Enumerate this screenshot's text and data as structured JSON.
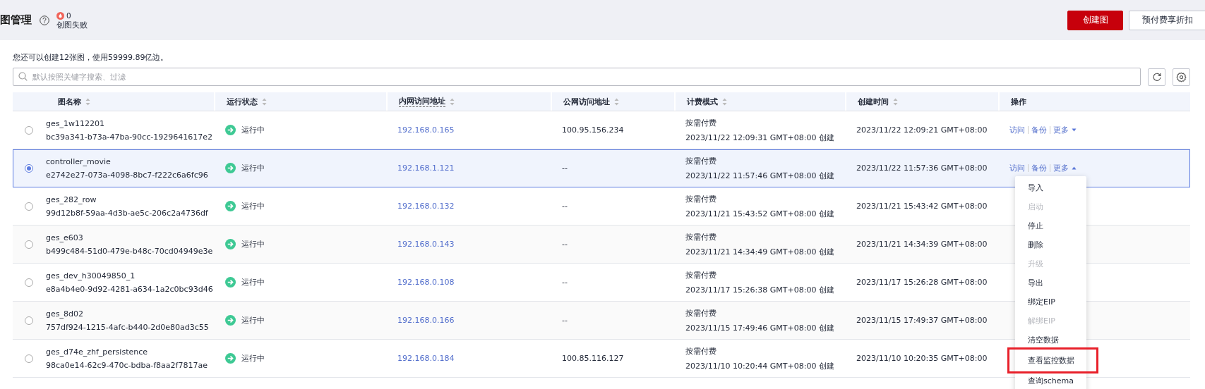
{
  "header": {
    "title": "图管理",
    "failed_count": "0",
    "failed_label": "创图失败",
    "buttons": [
      {
        "label": "创建图",
        "kind": "primary"
      },
      {
        "label": "预付费享折扣",
        "kind": "default"
      }
    ]
  },
  "quota_note": "您还可以创建12张图，使用59999.89亿边。",
  "search": {
    "placeholder": "默认按照关键字搜索、过滤"
  },
  "table": {
    "columns": [
      {
        "label": "图名称",
        "sortable": true,
        "dashed": false
      },
      {
        "label": "运行状态",
        "sortable": true,
        "dashed": false
      },
      {
        "label": "内网访问地址",
        "sortable": true,
        "dashed": true
      },
      {
        "label": "公网访问地址",
        "sortable": true,
        "dashed": false
      },
      {
        "label": "计费模式",
        "sortable": true,
        "dashed": false
      },
      {
        "label": "创建时间",
        "sortable": true,
        "dashed": false
      },
      {
        "label": "操作",
        "sortable": false,
        "dashed": false
      }
    ],
    "rows": [
      {
        "selected": false,
        "name": "ges_1w112201",
        "id": "bc39a341-b73a-47ba-90cc-1929641617e2",
        "status": "运行中",
        "private_ip": "192.168.0.165",
        "public_ip": "100.95.156.234",
        "billing": "按需付费",
        "billing_time": "2023/11/22 12:09:31 GMT+08:00 创建",
        "created": "2023/11/22 12:09:21 GMT+08:00",
        "actions": [
          "访问",
          "备份"
        ],
        "more": "更多",
        "expanded": false
      },
      {
        "selected": true,
        "name": "controller_movie",
        "id": "e2742e27-073a-4098-8bc7-f222c6a6fc96",
        "status": "运行中",
        "private_ip": "192.168.1.121",
        "public_ip": "--",
        "billing": "按需付费",
        "billing_time": "2023/11/22 11:57:46 GMT+08:00 创建",
        "created": "2023/11/22 11:57:36 GMT+08:00",
        "actions": [
          "访问",
          "备份"
        ],
        "more": "更多",
        "expanded": true
      },
      {
        "selected": false,
        "name": "ges_282_row",
        "id": "99d12b8f-59aa-4d3b-ae5c-206c2a4736df",
        "status": "运行中",
        "private_ip": "192.168.0.132",
        "public_ip": "--",
        "billing": "按需付费",
        "billing_time": "2023/11/21 15:43:52 GMT+08:00 创建",
        "created": "2023/11/21 15:43:42 GMT+08:00"
      },
      {
        "selected": false,
        "name": "ges_e603",
        "id": "b499c484-51d0-479e-b48c-70cd04949e3e",
        "status": "运行中",
        "private_ip": "192.168.0.143",
        "public_ip": "--",
        "billing": "按需付费",
        "billing_time": "2023/11/21 14:34:49 GMT+08:00 创建",
        "created": "2023/11/21 14:34:39 GMT+08:00"
      },
      {
        "selected": false,
        "name": "ges_dev_h30049850_1",
        "id": "e8a4b4e0-9d92-4281-a634-1a2c0bc93d46",
        "status": "运行中",
        "private_ip": "192.168.0.108",
        "public_ip": "--",
        "billing": "按需付费",
        "billing_time": "2023/11/17 15:26:38 GMT+08:00 创建",
        "created": "2023/11/17 15:26:28 GMT+08:00"
      },
      {
        "selected": false,
        "name": "ges_8d02",
        "id": "757df924-1215-4afc-b440-2d0e80ad3c55",
        "status": "运行中",
        "private_ip": "192.168.0.166",
        "public_ip": "--",
        "billing": "按需付费",
        "billing_time": "2023/11/15 17:49:46 GMT+08:00 创建",
        "created": "2023/11/15 17:49:37 GMT+08:00"
      },
      {
        "selected": false,
        "name": "ges_d74e_zhf_persistence",
        "id": "98ca0e14-62c9-470c-bdba-f8aa2f7817ae",
        "status": "运行中",
        "private_ip": "192.168.0.184",
        "public_ip": "100.85.116.127",
        "billing": "按需付费",
        "billing_time": "2023/11/10 10:20:44 GMT+08:00 创建",
        "created": "2023/11/10 10:20:35 GMT+08:00"
      }
    ]
  },
  "more_menu": [
    {
      "label": "导入",
      "disabled": false,
      "highlighted": false
    },
    {
      "label": "启动",
      "disabled": true,
      "highlighted": false
    },
    {
      "label": "停止",
      "disabled": false,
      "highlighted": false
    },
    {
      "label": "删除",
      "disabled": false,
      "highlighted": false
    },
    {
      "label": "升级",
      "disabled": true,
      "highlighted": false
    },
    {
      "label": "导出",
      "disabled": false,
      "highlighted": false
    },
    {
      "label": "绑定EIP",
      "disabled": false,
      "highlighted": false
    },
    {
      "label": "解绑EIP",
      "disabled": true,
      "highlighted": false
    },
    {
      "label": "清空数据",
      "disabled": false,
      "highlighted": false
    },
    {
      "label": "查看监控数据",
      "disabled": false,
      "highlighted": true
    },
    {
      "label": "查询schema",
      "disabled": false,
      "highlighted": false
    }
  ]
}
